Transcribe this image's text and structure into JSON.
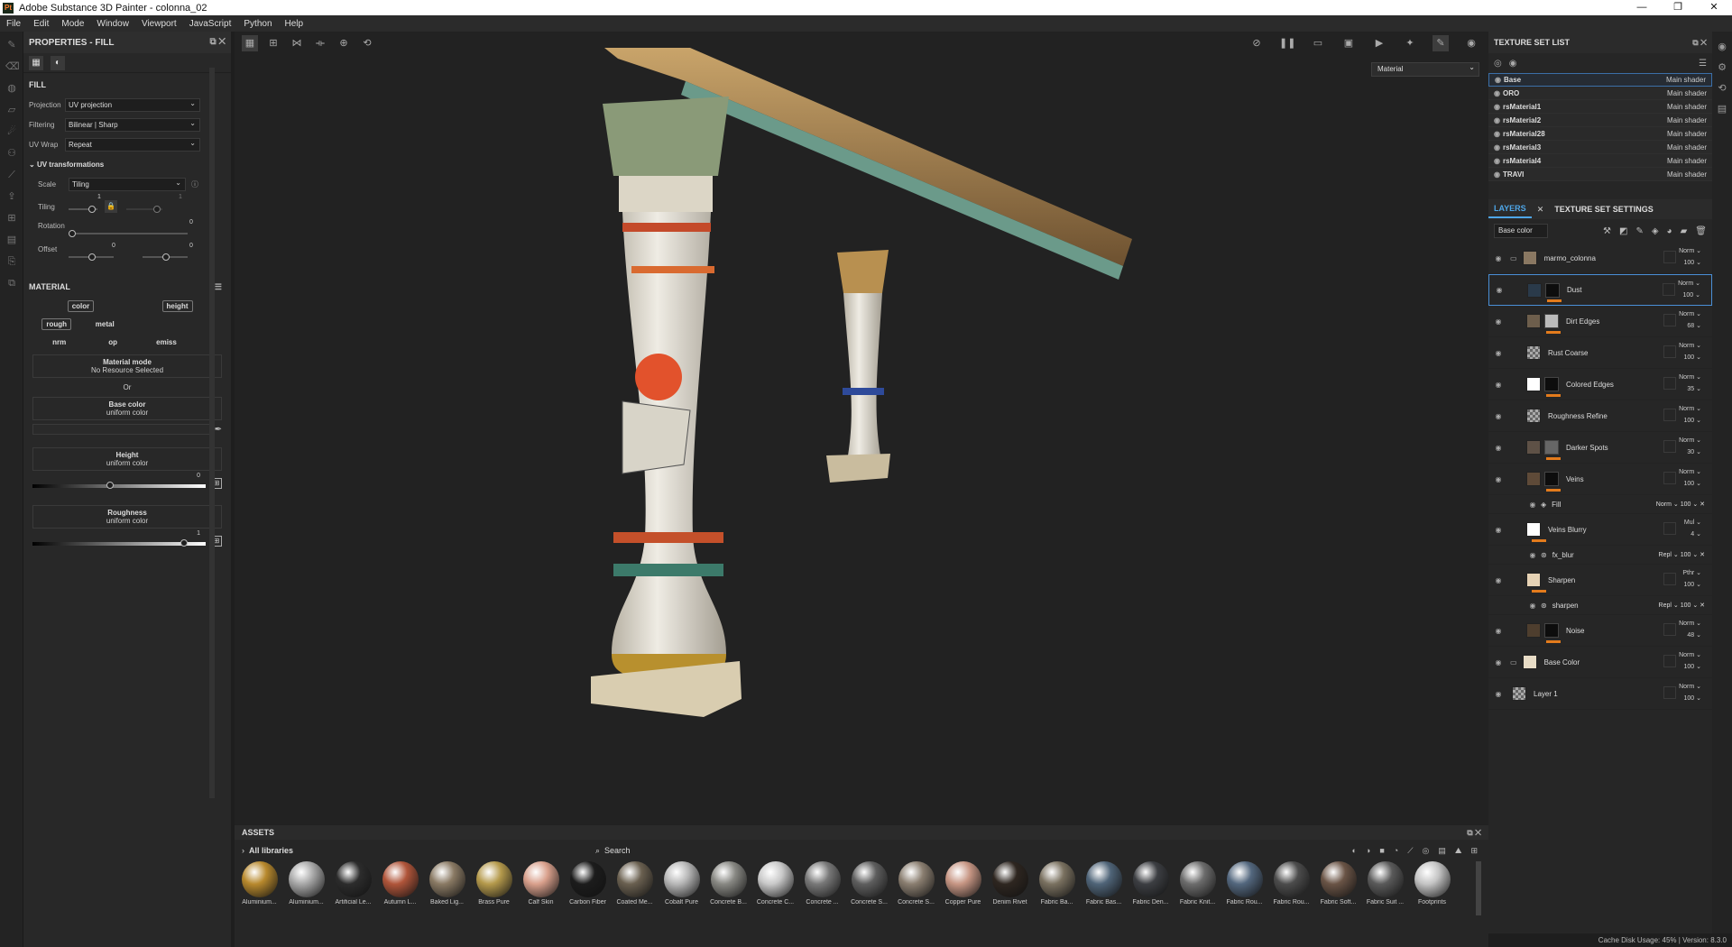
{
  "window": {
    "title": "Adobe Substance 3D Painter - colonna_02"
  },
  "menu": [
    "File",
    "Edit",
    "Mode",
    "Window",
    "Viewport",
    "JavaScript",
    "Python",
    "Help"
  ],
  "properties": {
    "title": "PROPERTIES - FILL",
    "fill_label": "FILL",
    "projection": {
      "label": "Projection",
      "value": "UV projection"
    },
    "filtering": {
      "label": "Filtering",
      "value": "Bilinear | Sharp"
    },
    "uvwrap": {
      "label": "UV Wrap",
      "value": "Repeat"
    },
    "uvtrans": "UV transformations",
    "scale": {
      "label": "Scale",
      "value": "Tiling"
    },
    "tiling": {
      "label": "Tiling",
      "value": "1",
      "value2": "1"
    },
    "rotation": {
      "label": "Rotation",
      "value": "0"
    },
    "offset": {
      "label": "Offset",
      "value": "0",
      "value2": "0"
    },
    "material_label": "MATERIAL",
    "channels": [
      {
        "label": "color",
        "on": true
      },
      {
        "label": "height",
        "on": true
      },
      {
        "label": "rough",
        "on": true
      },
      {
        "label": "metal",
        "on": false
      },
      {
        "label": "nrm",
        "on": false
      },
      {
        "label": "op",
        "on": false
      },
      {
        "label": "emiss",
        "on": false
      }
    ],
    "material_mode": {
      "title": "Material mode",
      "sub": "No Resource Selected"
    },
    "or": "Or",
    "base_color": {
      "title": "Base color",
      "sub": "uniform color"
    },
    "height": {
      "title": "Height",
      "sub": "uniform color",
      "value": "0"
    },
    "roughness": {
      "title": "Roughness",
      "sub": "uniform color",
      "value": "1"
    }
  },
  "viewport": {
    "material_select": "Material"
  },
  "texture_sets": {
    "title": "TEXTURE SET LIST",
    "items": [
      {
        "name": "Base",
        "shader": "Main shader"
      },
      {
        "name": "ORO",
        "shader": "Main shader"
      },
      {
        "name": "rsMaterial1",
        "shader": "Main shader"
      },
      {
        "name": "rsMaterial2",
        "shader": "Main shader"
      },
      {
        "name": "rsMaterial28",
        "shader": "Main shader"
      },
      {
        "name": "rsMaterial3",
        "shader": "Main shader"
      },
      {
        "name": "rsMaterial4",
        "shader": "Main shader"
      },
      {
        "name": "TRAVI",
        "shader": "Main shader"
      }
    ]
  },
  "layers": {
    "tab_layers": "LAYERS",
    "tab_settings": "TEXTURE SET SETTINGS",
    "channel": "Base color",
    "items": [
      {
        "name": "marmo_colonna",
        "blend": "Norm",
        "opacity": "100",
        "color": "#8a7862",
        "mask": false,
        "folder": true,
        "orange": false
      },
      {
        "name": "Dust",
        "blend": "Norm",
        "opacity": "100",
        "color": "#2a3a4a",
        "mask": true,
        "folder": false,
        "orange": true
      },
      {
        "name": "Dirt Edges",
        "blend": "Norm",
        "opacity": "68",
        "color": "#6d5e4c",
        "mask": true,
        "folder": false,
        "orange": true
      },
      {
        "name": "Rust Coarse",
        "blend": "Norm",
        "opacity": "100",
        "color": "#9a9a9a",
        "mask": false,
        "folder": false,
        "orange": false
      },
      {
        "name": "Colored Edges",
        "blend": "Norm",
        "opacity": "35",
        "color": "#ffffff",
        "mask": true,
        "folder": false,
        "orange": true
      },
      {
        "name": "Roughness Refine",
        "blend": "Norm",
        "opacity": "100",
        "color": "#9a9a9a",
        "mask": false,
        "folder": false,
        "orange": false
      },
      {
        "name": "Darker Spots",
        "blend": "Norm",
        "opacity": "30",
        "color": "#5e5146",
        "mask": true,
        "folder": false,
        "orange": true
      },
      {
        "name": "Veins",
        "blend": "Norm",
        "opacity": "100",
        "color": "#5e4a38",
        "mask": true,
        "folder": false,
        "orange": true
      }
    ],
    "fill_sub": {
      "name": "Fill",
      "blend": "Norm",
      "opacity": "100"
    },
    "veins_blurry": {
      "name": "Veins Blurry",
      "blend": "Mul",
      "opacity": "4"
    },
    "fx_blur": {
      "name": "fx_blur",
      "blend": "Repl",
      "opacity": "100"
    },
    "sharpen": {
      "name": "Sharpen",
      "blend": "Pthr",
      "opacity": "100"
    },
    "sharpen_sub": {
      "name": "sharpen",
      "blend": "Repl",
      "opacity": "100"
    },
    "noise": {
      "name": "Noise",
      "blend": "Norm",
      "opacity": "48"
    },
    "base_color_folder": {
      "name": "Base Color",
      "blend": "Norm",
      "opacity": "100"
    },
    "layer1": {
      "name": "Layer 1",
      "blend": "Norm",
      "opacity": "100"
    }
  },
  "assets": {
    "title": "ASSETS",
    "library": "All libraries",
    "search": "Search",
    "items": [
      {
        "name": "Aluminium...",
        "color": "#b8892d"
      },
      {
        "name": "Aluminium...",
        "color": "#a8a8a8"
      },
      {
        "name": "Artificial Le...",
        "color": "#2c2c2c"
      },
      {
        "name": "Autumn L...",
        "color": "#b0553a"
      },
      {
        "name": "Baked Lig...",
        "color": "#8a7a64"
      },
      {
        "name": "Brass Pure",
        "color": "#b59a4c"
      },
      {
        "name": "Calf Skin",
        "color": "#d9a08c"
      },
      {
        "name": "Carbon Fiber",
        "color": "#1c1c1c"
      },
      {
        "name": "Coated Me...",
        "color": "#6a6050"
      },
      {
        "name": "Cobalt Pure",
        "color": "#b7b7b7"
      },
      {
        "name": "Concrete B...",
        "color": "#888883"
      },
      {
        "name": "Concrete C...",
        "color": "#c9c9c9"
      },
      {
        "name": "Concrete ...",
        "color": "#787878"
      },
      {
        "name": "Concrete S...",
        "color": "#5e5e5e"
      },
      {
        "name": "Concrete S...",
        "color": "#8a7e70"
      },
      {
        "name": "Copper Pure",
        "color": "#c79684"
      },
      {
        "name": "Denim Rivet",
        "color": "#2e2620"
      },
      {
        "name": "Fabric Ba...",
        "color": "#7a7160"
      },
      {
        "name": "Fabric Bas...",
        "color": "#4f6478"
      },
      {
        "name": "Fabric Den...",
        "color": "#3c3e42"
      },
      {
        "name": "Fabric Knit...",
        "color": "#6c6c6c"
      },
      {
        "name": "Fabric Rou...",
        "color": "#53677e"
      },
      {
        "name": "Fabric Rou...",
        "color": "#4c4c4c"
      },
      {
        "name": "Fabric Soft...",
        "color": "#6a5446"
      },
      {
        "name": "Fabric Suit ...",
        "color": "#5a5a5a"
      },
      {
        "name": "Footprints",
        "color": "#c4c4c4"
      }
    ]
  },
  "status": {
    "cache": "Cache Disk Usage:",
    "pct": "45%",
    "version": "| Version: 8.3.0"
  }
}
